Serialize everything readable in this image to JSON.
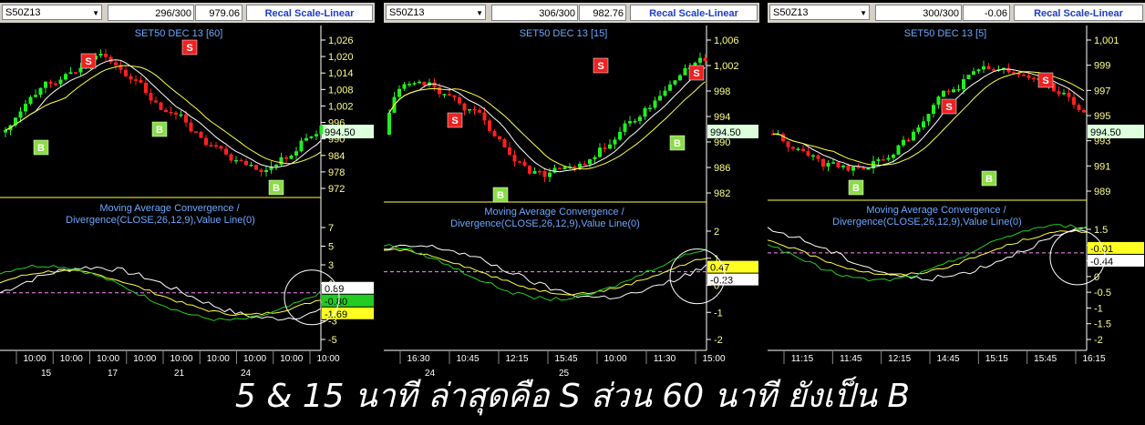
{
  "caption": "5 & 15 นาที ล่าสุดคือ S ส่วน 60 นาที ยังเป็น B",
  "colors": {
    "bull": "#22ee22",
    "bear": "#ff2020",
    "ma1": "#ffffff",
    "ma2": "#ffff44",
    "axis": "#ffff88",
    "title": "#6aa8ff",
    "macd": "#ffffff",
    "signal": "#ffff44",
    "hist": "#22cc22",
    "zero": "#ff88ff"
  },
  "panels": [
    {
      "symbol": "S50Z13",
      "count": "296/300",
      "last": "979.06",
      "scale_btn": "Recal Scale-Linear",
      "title": "SET50 DEC 13  [60]",
      "macd_title_1": "Moving Average Convergence /",
      "macd_title_2": "Divergence(CLOSE,26,12,9),Value Line(0)",
      "price_ticks": [
        "1,026",
        "1,020",
        "1,014",
        "1,008",
        "1,002",
        "996",
        "990",
        "984",
        "978",
        "972"
      ],
      "price_tag": "994.50",
      "macd_ticks": [
        "7",
        "5",
        "3",
        "1",
        "-1",
        "-3",
        "-5"
      ],
      "macd_tags": [
        {
          "text": "0.89",
          "bg": "#ffffff",
          "fg": "#000"
        },
        {
          "text": "-0.80",
          "bg": "#22cc22",
          "fg": "#000"
        },
        {
          "text": "-1.69",
          "bg": "#ffff22",
          "fg": "#000"
        }
      ],
      "time_labels": [
        "10:00",
        "10:00",
        "10:00",
        "10:00",
        "10:00",
        "10:00",
        "10:00",
        "10:00",
        "10:00"
      ],
      "date_labels": [
        "15",
        "17",
        "21",
        "24"
      ],
      "markers": [
        {
          "t": "S",
          "x": 97,
          "y": 67
        },
        {
          "t": "S",
          "x": 208,
          "y": 52
        },
        {
          "t": "B",
          "x": 45,
          "y": 162
        },
        {
          "t": "B",
          "x": 175,
          "y": 142
        },
        {
          "t": "B",
          "x": 303,
          "y": 206
        }
      ],
      "chart_data": {
        "type": "candlestick",
        "ylim": [
          968,
          1030
        ],
        "series": [
          {
            "name": "MACD",
            "values": [
              1.5,
              2.0,
              2.7,
              3.1,
              3.3,
              3.6,
              3.9,
              4.0,
              4.1,
              3.8,
              3.6,
              3.4,
              3.1,
              3.3,
              3.6,
              3.8,
              3.9,
              3.6,
              3.1,
              2.1,
              1.1,
              -0.4,
              -1.2,
              -1.6,
              -2.1,
              -1.6,
              -1.3,
              -0.6,
              0.7,
              1.0,
              0.9,
              0.89
            ]
          },
          {
            "name": "Signal",
            "values": [
              2.0,
              2.2,
              2.5,
              2.7,
              2.9,
              3.1,
              3.3,
              3.5,
              3.7,
              3.8,
              3.8,
              3.7,
              3.6,
              3.5,
              3.5,
              3.5,
              3.6,
              3.6,
              3.5,
              3.2,
              2.8,
              2.1,
              1.3,
              0.4,
              -0.7,
              -1.8,
              -2.4,
              -2.6,
              -2.4,
              -2.1,
              -1.9,
              -1.69
            ]
          },
          {
            "name": "Histogram",
            "values": [
              -0.5,
              -0.2,
              0.2,
              0.4,
              0.4,
              0.5,
              0.6,
              0.5,
              0.4,
              0,
              -0.2,
              -0.3,
              -0.5,
              -0.2,
              0.1,
              0.3,
              0.3,
              0,
              -0.4,
              -1.1,
              -1.7,
              -2.5,
              -2.5,
              -2.0,
              -1.4,
              0.2,
              1.1,
              2.0,
              3.1,
              3.1,
              2.8,
              -0.8
            ]
          }
        ]
      }
    },
    {
      "symbol": "S50Z13",
      "count": "306/300",
      "last": "982.76",
      "scale_btn": "Recal Scale-Linear",
      "title": "SET50 DEC 13  [15]",
      "macd_title_1": "Moving Average Convergence /",
      "macd_title_2": "Divergence(CLOSE,26,12,9),Value Line(0)",
      "price_ticks": [
        "1,006",
        "1,002",
        "998",
        "994",
        "990",
        "986",
        "982"
      ],
      "price_tag": "994.50",
      "macd_ticks": [
        "2",
        "1",
        "0",
        "-1",
        "-2"
      ],
      "macd_tags": [
        {
          "text": "0.47",
          "bg": "#ffff22",
          "fg": "#000"
        },
        {
          "text": "-0.23",
          "bg": "#ffffff",
          "fg": "#000"
        }
      ],
      "time_labels": [
        "16:30",
        "10:45",
        "12:15",
        "15:45",
        "10:00",
        "11:30",
        "15:00"
      ],
      "date_labels": [
        "24",
        "25"
      ],
      "markers": [
        {
          "t": "S",
          "x": 78,
          "y": 132
        },
        {
          "t": "S",
          "x": 238,
          "y": 72
        },
        {
          "t": "S",
          "x": 343,
          "y": 80
        },
        {
          "t": "B",
          "x": 128,
          "y": 214
        },
        {
          "t": "B",
          "x": 322,
          "y": 157
        }
      ],
      "chart_data": {
        "type": "candlestick",
        "ylim": [
          980,
          1008
        ],
        "series": []
      }
    },
    {
      "symbol": "S50Z13",
      "count": "300/300",
      "last": "-0.06",
      "scale_btn": "Recal Scale-Linear",
      "title": "SET50 DEC 13  [5]",
      "macd_title_1": "Moving Average Convergence /",
      "macd_title_2": "Divergence(CLOSE,26,12,9),Value Line(0)",
      "price_ticks": [
        "1,001",
        "999",
        "997",
        "995",
        "993",
        "991",
        "989"
      ],
      "price_tag": "994.50",
      "macd_ticks": [
        "1.5",
        "1",
        "0.5",
        "0",
        "-0.5",
        "-1",
        "-1.5",
        "-2"
      ],
      "macd_tags": [
        {
          "text": "-0.01",
          "bg": "#ffff22",
          "fg": "#000"
        },
        {
          "text": "-0.44",
          "bg": "#ffffff",
          "fg": "#000"
        }
      ],
      "time_labels": [
        "11:15",
        "11:45",
        "12:15",
        "14:45",
        "15:15",
        "15:45",
        "16:15"
      ],
      "date_labels": [],
      "markers": [
        {
          "t": "S",
          "x": 199,
          "y": 117
        },
        {
          "t": "S",
          "x": 305,
          "y": 88
        },
        {
          "t": "B",
          "x": 97,
          "y": 206
        },
        {
          "t": "B",
          "x": 243,
          "y": 196
        }
      ],
      "chart_data": {
        "type": "candlestick",
        "ylim": [
          988,
          1002
        ],
        "series": []
      }
    }
  ]
}
